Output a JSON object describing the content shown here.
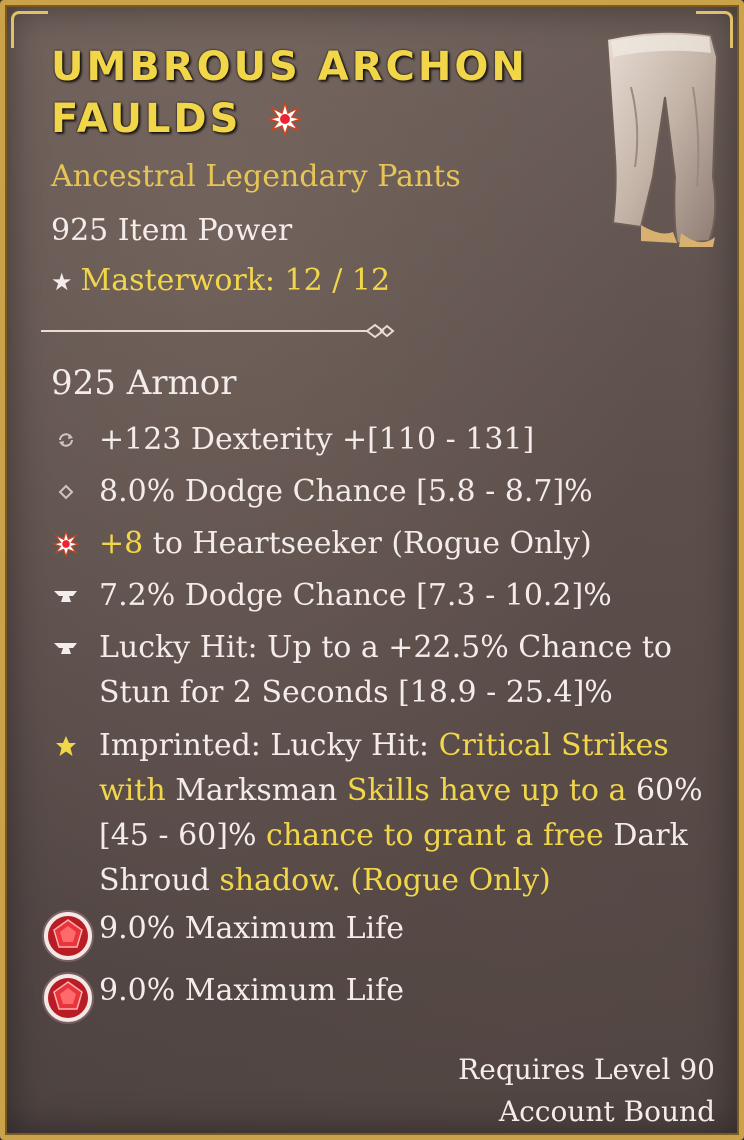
{
  "item": {
    "name_line1": "UMBROUS ARCHON",
    "name_line2": "FAULDS",
    "rarity_type": "Ancestral Legendary Pants",
    "item_power": "925 Item Power",
    "masterwork": "Masterwork: 12 / 12",
    "armor": "925 Armor"
  },
  "affixes": [
    {
      "icon": "swap-icon",
      "text": "+123 Dexterity +[110 - 131]"
    },
    {
      "icon": "diamond-icon",
      "text": "8.0% Dodge Chance [5.8 - 8.7]%"
    },
    {
      "icon": "legendary-burst-icon",
      "value": "+8",
      "text": " to Heartseeker (Rogue Only)"
    },
    {
      "icon": "anvil-icon",
      "text": "7.2% Dodge Chance [7.3 - 10.2]%"
    },
    {
      "icon": "anvil-icon",
      "text": "Lucky Hit: Up to a +22.5% Chance to Stun for 2 Seconds [18.9 - 25.4]%"
    }
  ],
  "aspect": {
    "icon": "star-icon",
    "parts": [
      "Imprinted: Lucky Hit: ",
      "Critical Strikes with",
      " Marksman ",
      "Skills have up to a",
      " 60% [45 - 60]% ",
      "chance to grant a free",
      " Dark Shroud ",
      "shadow. (Rogue Only)"
    ]
  },
  "sockets": [
    {
      "icon": "ruby-gem-icon",
      "text": "9.0% Maximum Life"
    },
    {
      "icon": "ruby-gem-icon",
      "text": "9.0% Maximum Life"
    }
  ],
  "footer": {
    "requires": "Requires Level 90",
    "bound": "Account Bound"
  },
  "colors": {
    "gold": "#f2d64a",
    "frame": "#c9a24a",
    "text": "#f4ecea",
    "gem": "#d8202a"
  }
}
